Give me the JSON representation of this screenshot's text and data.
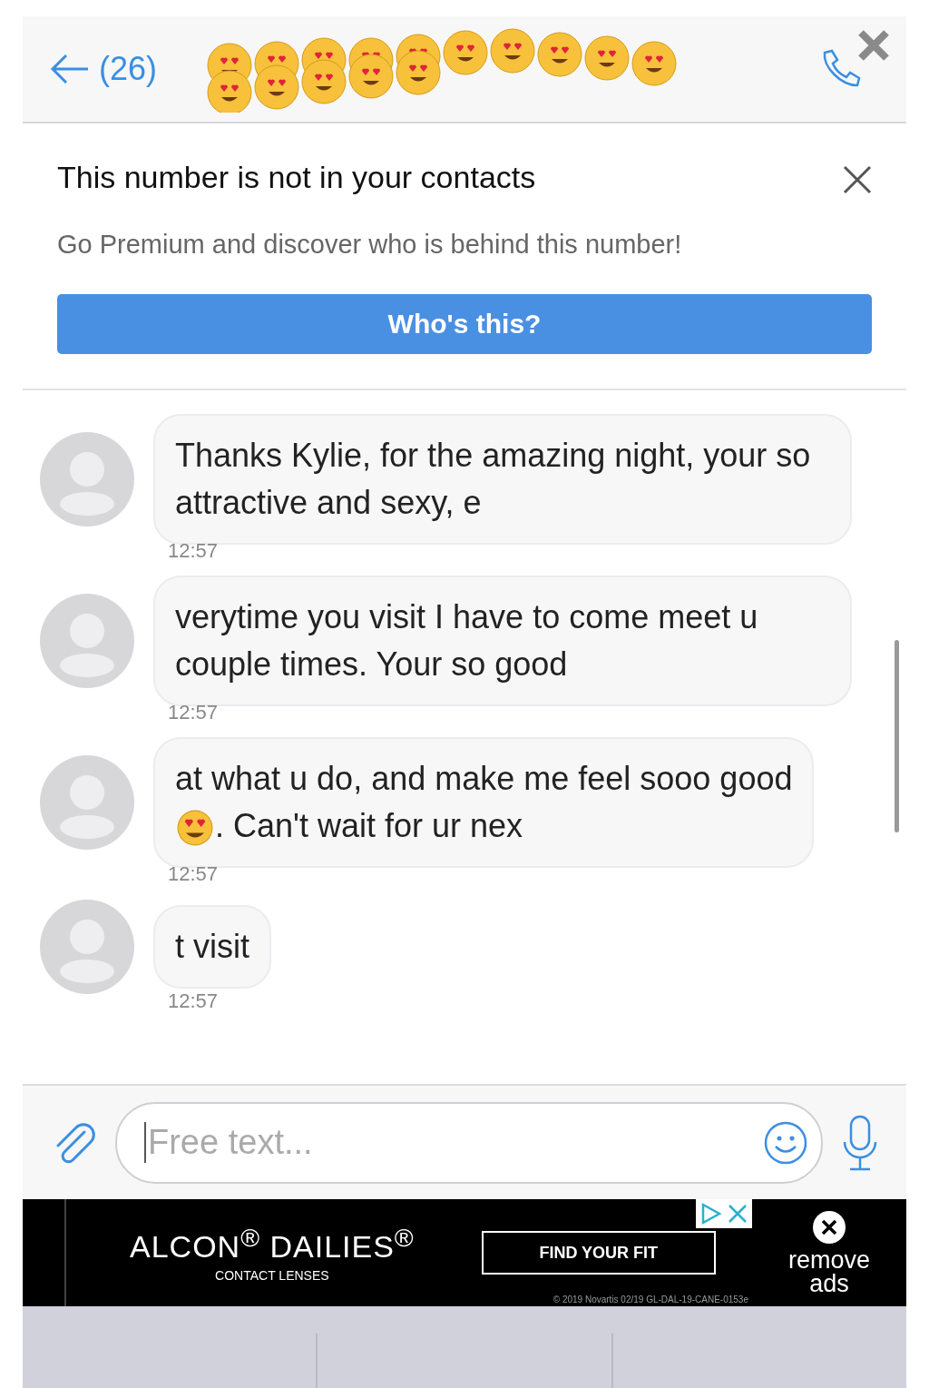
{
  "header": {
    "unread_count": "(26)"
  },
  "banner": {
    "title": "This number is not in your contacts",
    "subtitle": "Go Premium and discover who is behind this number!",
    "button": "Who's this?"
  },
  "messages": [
    {
      "text": "Thanks Kylie, for the amazing night, your so attractive and sexy, e",
      "time": "12:57"
    },
    {
      "text": "verytime you visit I have to come meet u couple times. Your so good",
      "time": "12:57"
    },
    {
      "text": "at what u do, and make me feel sooo good",
      "text_after_emoji": ". Can't wait for ur nex",
      "time": "12:57"
    },
    {
      "text": "t visit",
      "time": "12:57"
    }
  ],
  "composer": {
    "placeholder": "Free text..."
  },
  "ad": {
    "brand": "ALCON$^{®}$ DAILIES$^{®}$",
    "tagline": "CONTACT LENSES",
    "cta": "FIND YOUR FIT",
    "legal": "© 2019 Novartis 02/19  GL-DAL-19-CANE-0153e",
    "remove": "remove ads"
  }
}
